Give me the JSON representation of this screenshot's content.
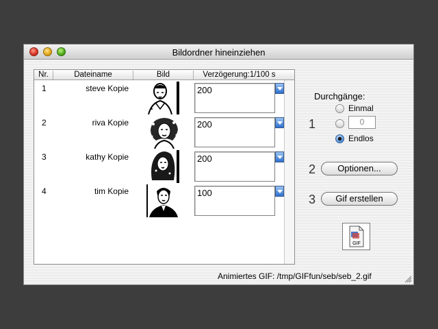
{
  "window": {
    "title": "Bildordner hineinziehen"
  },
  "table": {
    "headers": {
      "nr": "Nr.",
      "filename": "Dateiname",
      "image": "Bild",
      "delay": "Verzögerung:1/100 s"
    },
    "rows": [
      {
        "nr": "1",
        "filename": "steve Kopie",
        "delay": "200",
        "thumb": "portrait-steve"
      },
      {
        "nr": "2",
        "filename": "riva Kopie",
        "delay": "200",
        "thumb": "portrait-riva"
      },
      {
        "nr": "3",
        "filename": "kathy Kopie",
        "delay": "200",
        "thumb": "portrait-kathy"
      },
      {
        "nr": "4",
        "filename": "tim Kopie",
        "delay": "100",
        "thumb": "portrait-tim"
      }
    ]
  },
  "steps": {
    "one": "1",
    "two": "2",
    "three": "3"
  },
  "loops": {
    "heading": "Durchgänge:",
    "once": "Einmal",
    "count_value": "0",
    "endless": "Endlos",
    "selected": "Endlos"
  },
  "buttons": {
    "options": "Optionen...",
    "create": "Gif erstellen"
  },
  "gif_icon": {
    "label": "GIF",
    "icon": "gif-document-icon"
  },
  "status": {
    "text": "Animiertes GIF: /tmp/GIFfun/seb/seb_2.gif"
  },
  "colors": {
    "accent": "#2c6fd0",
    "desktop": "#3d3d3d"
  }
}
